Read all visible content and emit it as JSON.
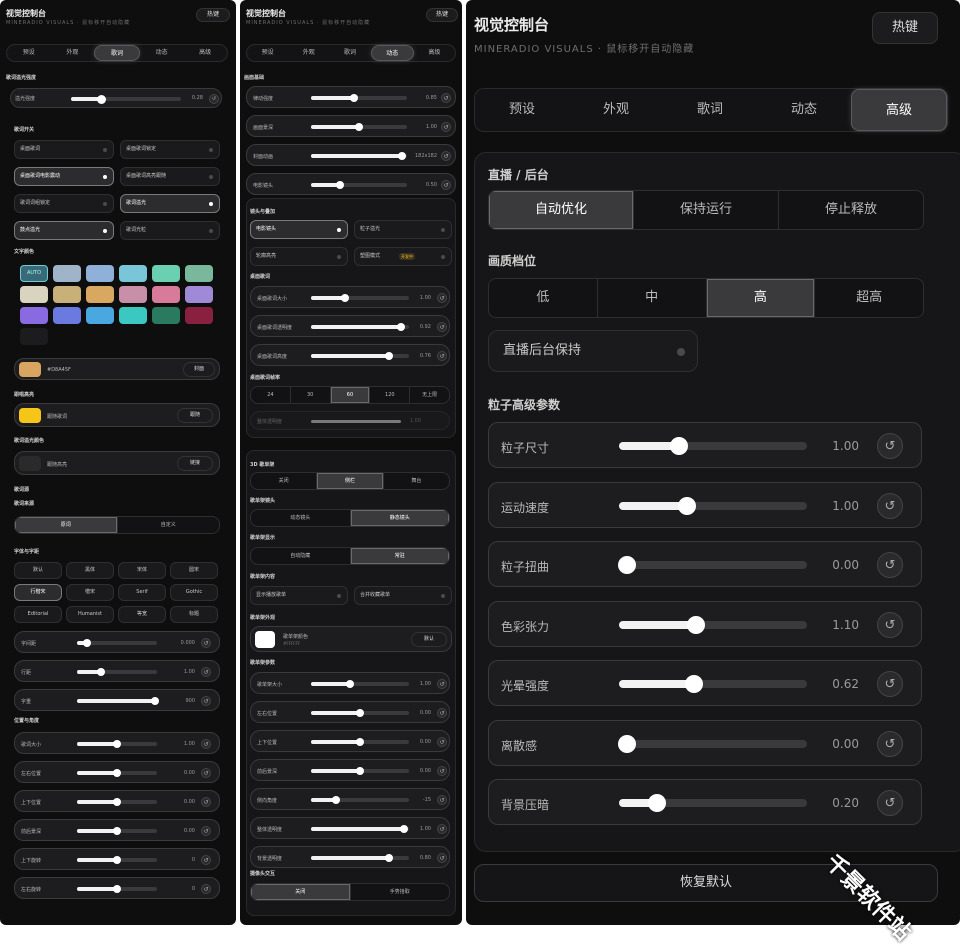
{
  "common": {
    "title": "视觉控制台",
    "subtitle": "MINERADIO VISUALS · 鼠标移开自动隐藏",
    "hotkey": "热键",
    "tabs": [
      "预设",
      "外观",
      "歌词",
      "动态",
      "高级"
    ]
  },
  "p1": {
    "sec_glow": "歌词溢光强度",
    "glow": {
      "label": "溢光强度",
      "value": "0.28",
      "pct": 0.28
    },
    "sec_switch": "歌词开关",
    "switches": [
      {
        "label": "桌面歌词",
        "on": false
      },
      {
        "label": "桌面歌词锁定",
        "on": false
      },
      {
        "label": "桌面歌词电影震动",
        "on": true
      },
      {
        "label": "桌面歌词高亮跟随",
        "on": false
      },
      {
        "label": "歌词词组锁定",
        "on": false
      },
      {
        "label": "歌词溢光",
        "on": true
      },
      {
        "label": "鼓点溢光",
        "on": true
      },
      {
        "label": "歌词光粒",
        "on": false
      }
    ],
    "sec_color": "文字颜色",
    "swatch_auto": "AUTO",
    "swatches": [
      "#9fb4c8",
      "#8fb0d8",
      "#78c6d8",
      "#6ad0b0",
      "#7ab89e",
      "#d8d4c0",
      "#c8b078",
      "#d8a860",
      "#c890a8",
      "#d87a9a",
      "#a08ad8",
      "#8a6ae0",
      "#6a7ae0",
      "#4aa8e0",
      "#3ac8c0",
      "#2a7a60",
      "#8a2040",
      "#1c1c1e"
    ],
    "current": {
      "hex": "#D8A45F",
      "btn": "封面"
    },
    "sec_follow": "跟唱高亮",
    "follow": {
      "text": "跟随歌词",
      "btn": "跟随"
    },
    "sec_gc": "歌词溢光颜色",
    "gc": {
      "text": "跟随高亮",
      "btn": "链接"
    },
    "sec_src": "歌词源",
    "sec_src2": "歌词来源",
    "src_opts": [
      "原词",
      "自定义"
    ],
    "sec_font": "字体与字距",
    "fonts": [
      "默认",
      "黑体",
      "宋体",
      "圆宋",
      "行楷宋",
      "楷宋",
      "Serif",
      "Gothic",
      "Editorial",
      "Humanist",
      "等宽",
      "标题"
    ],
    "fsl": [
      {
        "label": "字间距",
        "value": "0.000",
        "pct": 0.12
      },
      {
        "label": "行距",
        "value": "1.00",
        "pct": 0.3
      },
      {
        "label": "字重",
        "value": "900",
        "pct": 0.98
      }
    ],
    "sec_pos": "位置与角度",
    "psl": [
      {
        "label": "歌词大小",
        "value": "1.00",
        "pct": 0.5
      },
      {
        "label": "左右位置",
        "value": "0.00",
        "pct": 0.5
      },
      {
        "label": "上下位置",
        "value": "0.00",
        "pct": 0.5
      },
      {
        "label": "前后景深",
        "value": "0.00",
        "pct": 0.5
      },
      {
        "label": "上下旋转",
        "value": "0",
        "pct": 0.5
      },
      {
        "label": "左右旋转",
        "value": "0",
        "pct": 0.5
      }
    ]
  },
  "p2": {
    "sec1": "画面基础",
    "s1": [
      {
        "label": "律动强度",
        "value": "0.85",
        "pct": 0.45
      },
      {
        "label": "画面景深",
        "value": "1.00",
        "pct": 0.5
      },
      {
        "label": "封面动画",
        "value": "182x182",
        "pct": 0.95
      },
      {
        "label": "电影镜头",
        "value": "0.50",
        "pct": 0.3
      }
    ],
    "sec2": "镜头与叠加",
    "t2": [
      {
        "label": "电影镜头",
        "on": true
      },
      {
        "label": "粒子溢光",
        "on": false
      },
      {
        "label": "轮廓高亮",
        "on": false
      },
      {
        "label": "塑图模式",
        "on": false,
        "badge": "开发中"
      }
    ],
    "sec3": "桌面歌词",
    "s3": [
      {
        "label": "桌面歌词大小",
        "value": "1.00",
        "pct": 0.35
      },
      {
        "label": "桌面歌词透明度",
        "value": "0.92",
        "pct": 0.92
      },
      {
        "label": "桌面歌词高度",
        "value": "0.76",
        "pct": 0.8
      }
    ],
    "sec4": "桌面歌词帧率",
    "fps": [
      "24",
      "30",
      "60",
      "120",
      "无上限"
    ],
    "dis": {
      "label": "整体透明度",
      "value": "1.00"
    },
    "sec5": "3D 歌单架",
    "mode": [
      "关闭",
      "侧栏",
      "舞台"
    ],
    "sec6": "歌单架镜头",
    "cam": [
      "动态镜头",
      "静态镜头"
    ],
    "sec7": "歌单架显示",
    "disp": [
      "自动隐藏",
      "常驻"
    ],
    "sec8": "歌单架内容",
    "cont": [
      {
        "label": "显示播放歌单",
        "on": false
      },
      {
        "label": "合并收藏歌单",
        "on": false
      }
    ],
    "sec9": "歌单架外观",
    "ap": {
      "name": "歌单架颜色",
      "hex": "#FFFFFF",
      "btn": "默认"
    },
    "sec10": "歌单架参数",
    "s10": [
      {
        "label": "歌单架大小",
        "value": "1.00",
        "pct": 0.4
      },
      {
        "label": "左右位置",
        "value": "0.00",
        "pct": 0.5
      },
      {
        "label": "上下位置",
        "value": "0.00",
        "pct": 0.5
      },
      {
        "label": "前后景深",
        "value": "0.00",
        "pct": 0.5
      },
      {
        "label": "侧向角度",
        "value": "-15",
        "pct": 0.25
      },
      {
        "label": "整体透明度",
        "value": "1.00",
        "pct": 0.95
      },
      {
        "label": "背景透明度",
        "value": "0.80",
        "pct": 0.8
      }
    ],
    "sec11": "摄像头交互",
    "cami": [
      "关闭",
      "手势拾取"
    ]
  },
  "p3": {
    "sec_live": "直播 / 后台",
    "live": [
      "自动优化",
      "保持运行",
      "停止释放"
    ],
    "sec_q": "画质档位",
    "quality": [
      "低",
      "中",
      "高",
      "超高"
    ],
    "keep": "直播后台保持",
    "sec_adv": "粒子高级参数",
    "adv": [
      {
        "label": "粒子尺寸",
        "value": "1.00",
        "pct": 0.32
      },
      {
        "label": "运动速度",
        "value": "1.00",
        "pct": 0.36
      },
      {
        "label": "粒子扭曲",
        "value": "0.00",
        "pct": 0.04
      },
      {
        "label": "色彩张力",
        "value": "1.10",
        "pct": 0.41
      },
      {
        "label": "光晕强度",
        "value": "0.62",
        "pct": 0.4
      },
      {
        "label": "离散感",
        "value": "0.00",
        "pct": 0.04
      },
      {
        "label": "背景压暗",
        "value": "0.20",
        "pct": 0.2
      }
    ],
    "reset": "恢复默认"
  },
  "watermark": "千景软件站",
  "colors": {
    "accent": "#f2f2f2",
    "bg": "#0e0e0f",
    "swatch_current": "#D8A45F",
    "follow": "#f5c518"
  }
}
